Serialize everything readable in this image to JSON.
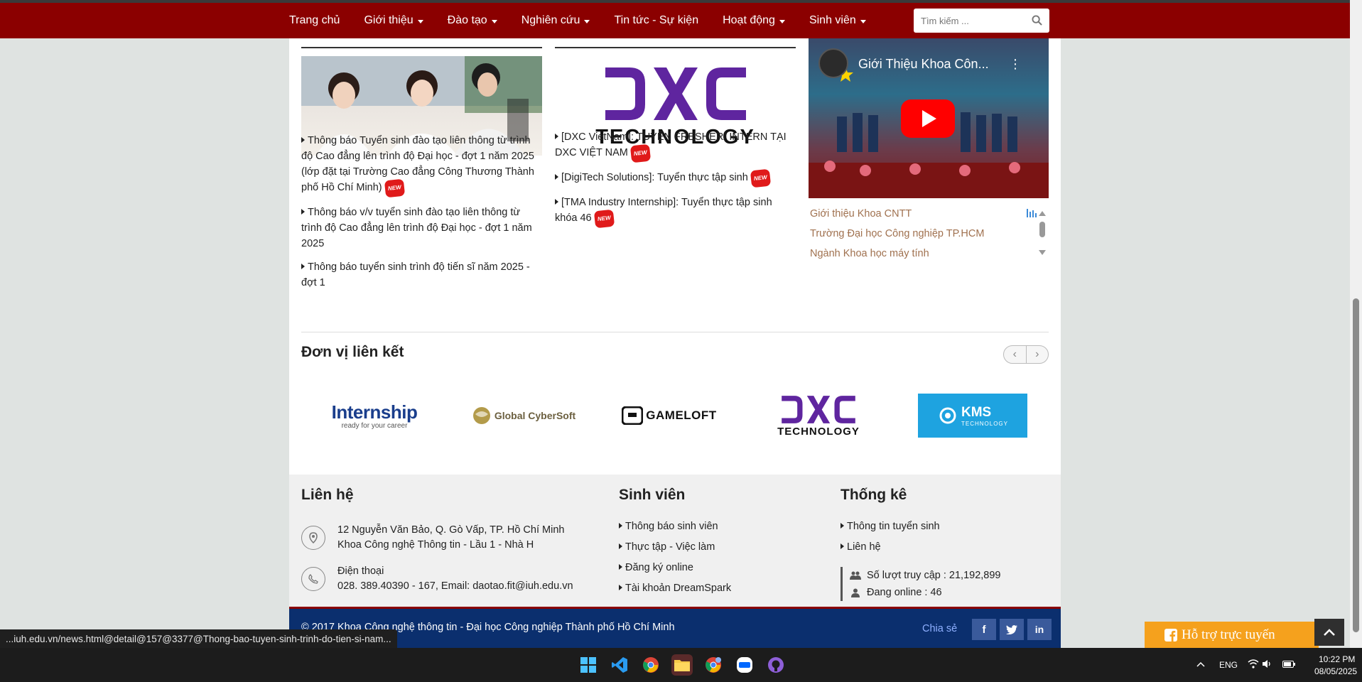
{
  "nav": {
    "items": [
      {
        "label": "Trang chủ",
        "dropdown": false
      },
      {
        "label": "Giới thiệu",
        "dropdown": true
      },
      {
        "label": "Đào tạo",
        "dropdown": true
      },
      {
        "label": "Nghiên cứu",
        "dropdown": true
      },
      {
        "label": "Tin tức - Sự kiện",
        "dropdown": false
      },
      {
        "label": "Hoạt động",
        "dropdown": true
      },
      {
        "label": "Sinh viên",
        "dropdown": true
      }
    ],
    "search_placeholder": "Tìm kiếm ..."
  },
  "admissions_news": [
    "Thông báo Tuyển sinh đào tạo liên thông từ trình độ Cao đẳng lên trình độ Đại học - đợt 1 năm 2025 (lớp đặt tại Trường Cao đẳng Công Thương Thành phố Hồ Chí Minh)",
    "Thông báo v/v tuyển sinh đào tạo liên thông từ trình độ Cao đẳng lên trình độ Đại học - đợt 1 năm 2025",
    "Thông báo tuyển sinh trình độ tiến sĩ năm 2025 - đợt 1"
  ],
  "new_badge": "NEW",
  "dxc_logo_text": "TECHNOLOGY",
  "jobs_news": [
    "[DXC VietNam]: TUYỂN FRESHER/ INTERN TẠI DXC VIỆT NAM",
    "[DigiTech Solutions]: Tuyển thực tập sinh",
    "[TMA Industry Internship]: Tuyển thực tập sinh khóa 46"
  ],
  "video": {
    "title": "Giới Thiệu Khoa Côn...",
    "links": [
      "Giới thiệu Khoa CNTT",
      "Trường Đại học Công nghiệp TP.HCM",
      "Ngành Khoa học máy tính"
    ]
  },
  "partners": {
    "title": "Đơn vị liên kết",
    "logos": [
      {
        "name": "Internship",
        "tagline": "ready for your career"
      },
      {
        "name": "Global CyberSoft"
      },
      {
        "name": "GAMELOFT"
      },
      {
        "name": "TECHNOLOGY"
      },
      {
        "name": "KMS",
        "tagline": "TECHNOLOGY"
      }
    ]
  },
  "footer": {
    "contact_title": "Liên hệ",
    "address_line1": "12 Nguyễn Văn Bảo, Q. Gò Vấp, TP. Hồ Chí Minh",
    "address_line2": "Khoa Công nghệ Thông tin - Lầu 1 - Nhà H",
    "phone_label": "Điện thoại",
    "phone_line": "028. 389.40390 - 167, Email: daotao.fit@iuh.edu.vn",
    "students_title": "Sinh viên",
    "students_links": [
      "Thông báo sinh viên",
      "Thực tập - Việc làm",
      "Đăng ký online",
      "Tài khoản DreamSpark"
    ],
    "stats_title": "Thống kê",
    "stats_links": [
      "Thông tin tuyển sinh",
      "Liên hệ"
    ],
    "visits": "Số lượt truy cập : 21,192,899",
    "online": "Đang online : 46"
  },
  "copyright": "© 2017 Khoa Công nghệ thông tin - Đại học Công nghiệp Thành phố Hồ Chí Minh",
  "share_label": "Chia sẻ",
  "status_url": "...iuh.edu.vn/news.html@detail@157@3377@Thong-bao-tuyen-sinh-trinh-do-tien-si-nam...",
  "support_label": "Hỗ trợ trực tuyến",
  "tray": {
    "lang": "ENG",
    "time": "10:22 PM",
    "date": "08/05/2025"
  },
  "colors": {
    "nav": "#8b0000",
    "footer_bar": "#0b2f6e",
    "support": "#f5a11d",
    "dxc": "#5f259f"
  }
}
